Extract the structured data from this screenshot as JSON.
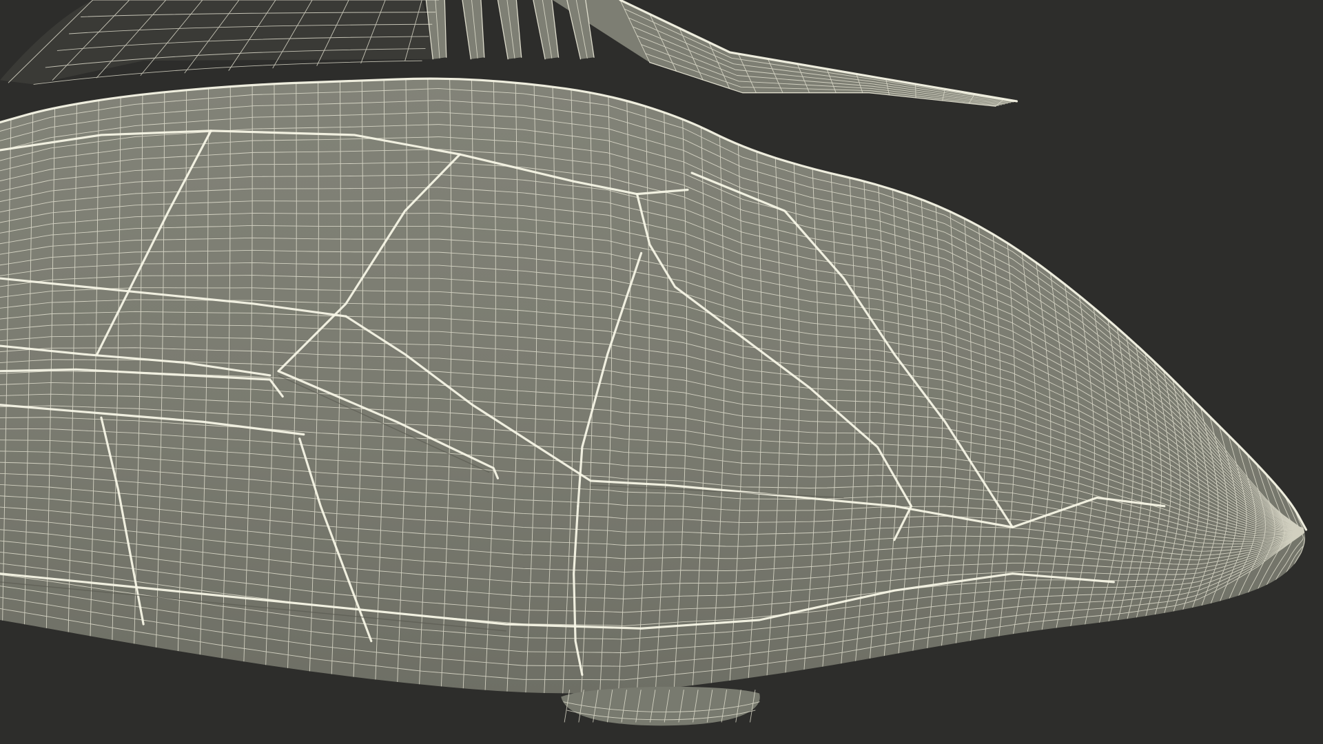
{
  "colors": {
    "background": "#2d2d2b",
    "surface": "#7c7d72",
    "surface_dark": "#6d6e64",
    "wire": "#ecead9"
  }
}
